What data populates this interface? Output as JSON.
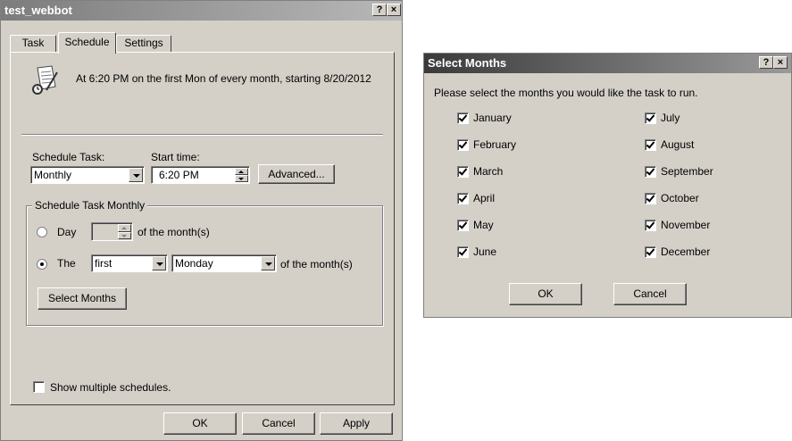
{
  "task_window": {
    "title": "test_webbot",
    "title_buttons": {
      "help": "?",
      "close": "×"
    },
    "tabs": [
      {
        "label": "Task"
      },
      {
        "label": "Schedule"
      },
      {
        "label": "Settings"
      }
    ],
    "summary": "At 6:20 PM on the first Mon of every month, starting 8/20/2012",
    "schedule_task_label": "Schedule Task:",
    "schedule_task_value": "Monthly",
    "start_time_label": "Start time:",
    "start_time_value": "6:20 PM",
    "advanced_label": "Advanced...",
    "group_title": "Schedule Task Monthly",
    "day_option_label": "Day",
    "day_value": "",
    "of_month_1": "of the month(s)",
    "the_option_label": "The",
    "the_week_value": "first",
    "the_day_value": "Monday",
    "of_month_2": "of the month(s)",
    "select_months_label": "Select Months",
    "show_multiple_label": "Show multiple schedules.",
    "ok_label": "OK",
    "cancel_label": "Cancel",
    "apply_label": "Apply"
  },
  "months_dialog": {
    "title": "Select Months",
    "title_buttons": {
      "help": "?",
      "close": "×"
    },
    "prompt": "Please select the months you would like the task to run.",
    "months": [
      {
        "label": "January",
        "checked": true
      },
      {
        "label": "February",
        "checked": true
      },
      {
        "label": "March",
        "checked": true
      },
      {
        "label": "April",
        "checked": true
      },
      {
        "label": "May",
        "checked": true
      },
      {
        "label": "June",
        "checked": true
      },
      {
        "label": "July",
        "checked": true
      },
      {
        "label": "August",
        "checked": true
      },
      {
        "label": "September",
        "checked": true
      },
      {
        "label": "October",
        "checked": true
      },
      {
        "label": "November",
        "checked": true
      },
      {
        "label": "December",
        "checked": true
      }
    ],
    "ok_label": "OK",
    "cancel_label": "Cancel"
  },
  "icons": {
    "task_icon": "scheduled-task-icon"
  }
}
